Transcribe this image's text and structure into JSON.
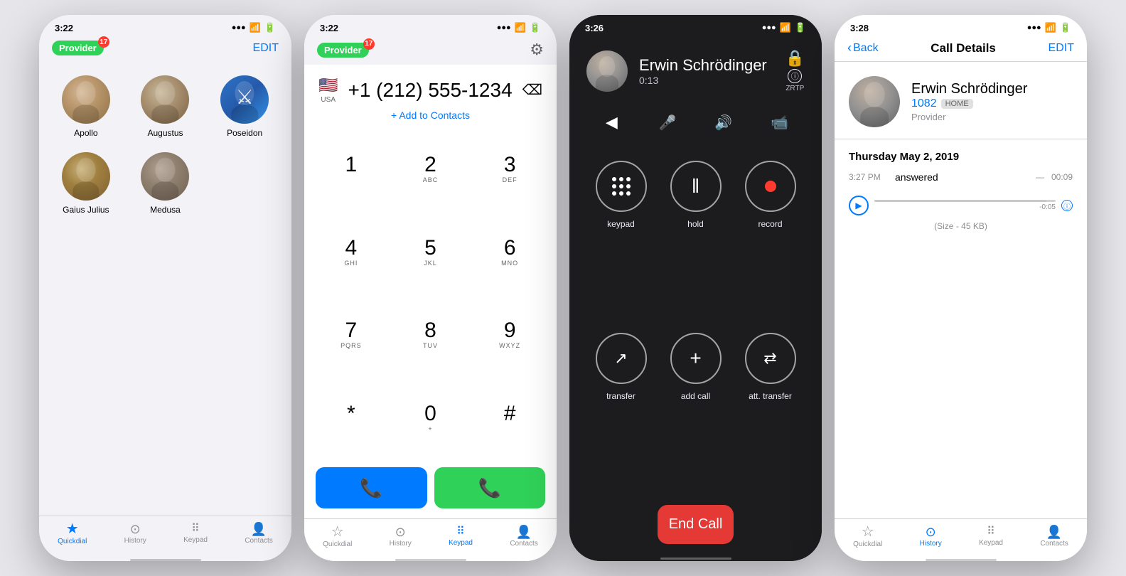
{
  "screen1": {
    "time": "3:22",
    "provider": "Provider",
    "badge_count": "17",
    "edit": "EDIT",
    "contacts": [
      {
        "name": "Apollo",
        "avatar_class": "av-apollo"
      },
      {
        "name": "Augustus",
        "avatar_class": "av-augustus"
      },
      {
        "name": "Poseidon",
        "avatar_class": "av-poseidon"
      },
      {
        "name": "Gaius Julius",
        "avatar_class": "av-gaius"
      },
      {
        "name": "Medusa",
        "avatar_class": "av-medusa"
      }
    ],
    "tabs": [
      {
        "label": "Quickdial",
        "icon": "★",
        "active": true
      },
      {
        "label": "History",
        "icon": "⊙",
        "active": false
      },
      {
        "label": "Keypad",
        "icon": "⠿",
        "active": false
      },
      {
        "label": "Contacts",
        "icon": "👤",
        "active": false
      }
    ]
  },
  "screen2": {
    "time": "3:22",
    "provider": "Provider",
    "badge_count": "17",
    "gear": "⚙",
    "phone_number": "+1 (212) 555-1234",
    "country": "USA",
    "add_to_contacts": "+ Add to Contacts",
    "keys": [
      {
        "num": "1",
        "alpha": ""
      },
      {
        "num": "2",
        "alpha": "ABC"
      },
      {
        "num": "3",
        "alpha": "DEF"
      },
      {
        "num": "4",
        "alpha": "GHI"
      },
      {
        "num": "5",
        "alpha": "JKL"
      },
      {
        "num": "6",
        "alpha": "MNO"
      },
      {
        "num": "7",
        "alpha": "PQRS"
      },
      {
        "num": "8",
        "alpha": "TUV"
      },
      {
        "num": "9",
        "alpha": "WXYZ"
      },
      {
        "num": "*",
        "alpha": ""
      },
      {
        "num": "0",
        "alpha": "+"
      },
      {
        "num": "#",
        "alpha": ""
      }
    ],
    "tabs": [
      {
        "label": "Quickdial",
        "icon": "★",
        "active": false
      },
      {
        "label": "History",
        "icon": "⊙",
        "active": false
      },
      {
        "label": "Keypad",
        "icon": "⠿",
        "active": true
      },
      {
        "label": "Contacts",
        "icon": "👤",
        "active": false
      }
    ]
  },
  "screen3": {
    "time": "3:26",
    "caller_name": "Erwin Schrödinger",
    "call_duration": "0:13",
    "zrtp_label": "ZRTP",
    "actions": [
      {
        "label": "keypad",
        "type": "keypad"
      },
      {
        "label": "hold",
        "type": "pause"
      },
      {
        "label": "record",
        "type": "record"
      },
      {
        "label": "transfer",
        "type": "transfer"
      },
      {
        "label": "add call",
        "type": "add"
      },
      {
        "label": "att. transfer",
        "type": "att"
      }
    ],
    "end_call": "End Call"
  },
  "screen4": {
    "time": "3:28",
    "back": "Back",
    "title": "Call Details",
    "edit": "EDIT",
    "caller_name": "Erwin Schrödinger",
    "caller_number": "1082",
    "caller_tag": "HOME",
    "caller_provider": "Provider",
    "history_date": "Thursday May 2, 2019",
    "entries": [
      {
        "time": "3:27 PM",
        "status": "answered",
        "duration_start": "—",
        "duration_end": "00:09"
      }
    ],
    "player": {
      "current": "-0:05",
      "file_size": "(Size - 45 KB)"
    },
    "tabs": [
      {
        "label": "Quickdial",
        "icon": "★",
        "active": false
      },
      {
        "label": "History",
        "icon": "⊙",
        "active": true
      },
      {
        "label": "Keypad",
        "icon": "⠿",
        "active": false
      },
      {
        "label": "Contacts",
        "icon": "👤",
        "active": false
      }
    ]
  }
}
